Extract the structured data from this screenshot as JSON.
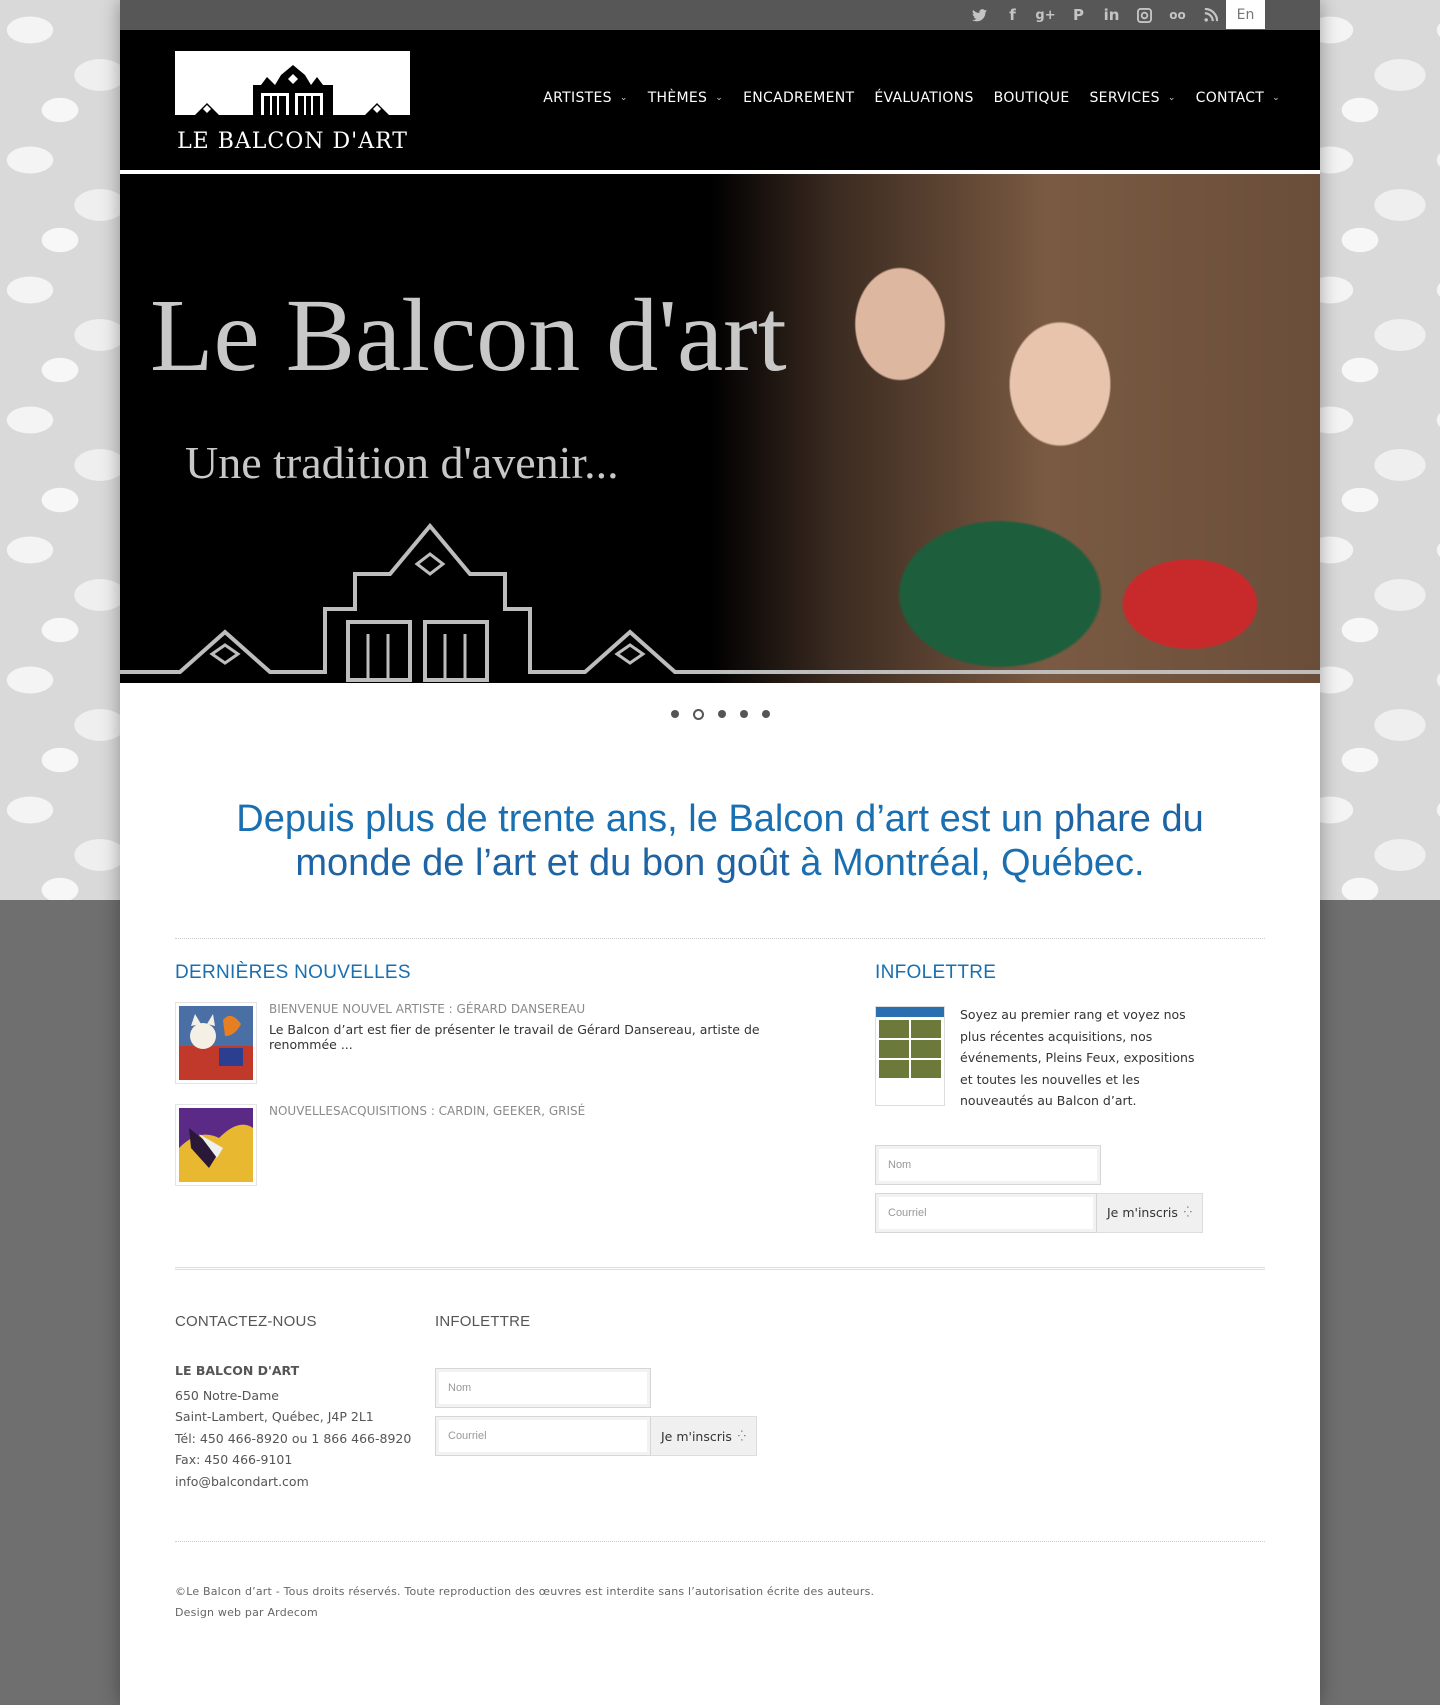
{
  "topbar": {
    "social": [
      {
        "name": "twitter-icon",
        "glyph": "🐦"
      },
      {
        "name": "facebook-icon",
        "glyph": "f"
      },
      {
        "name": "google-plus-icon",
        "glyph": "g+"
      },
      {
        "name": "pinterest-icon",
        "glyph": "P"
      },
      {
        "name": "linkedin-icon",
        "glyph": "in"
      },
      {
        "name": "instagram-icon",
        "glyph": "◙"
      },
      {
        "name": "tripadvisor-icon",
        "glyph": "oo"
      },
      {
        "name": "rss-icon",
        "glyph": ")"
      }
    ],
    "language": "En"
  },
  "header": {
    "logo_text": "LE BALCON D'ART",
    "nav": [
      {
        "label": "ARTISTES",
        "dropdown": true
      },
      {
        "label": "THÈMES",
        "dropdown": true
      },
      {
        "label": "ENCADREMENT",
        "dropdown": false
      },
      {
        "label": "ÉVALUATIONS",
        "dropdown": false
      },
      {
        "label": "BOUTIQUE",
        "dropdown": false
      },
      {
        "label": "SERVICES",
        "dropdown": true
      },
      {
        "label": "CONTACT",
        "dropdown": true
      }
    ]
  },
  "hero": {
    "title": "Le Balcon d'art",
    "subtitle": "Une tradition d'avenir...",
    "slides_count": 5,
    "active_slide": 2
  },
  "tagline": {
    "part1": "Depuis plus de trente ans, le Balcon d’art est un ",
    "part2": "phare du monde de l’art et du bon goût",
    "part3": " à Montréal, Québec."
  },
  "news": {
    "heading": "DERNIÈRES NOUVELLES",
    "items": [
      {
        "title": "BIENVENUE NOUVEL ARTISTE : GÉRARD DANSEREAU",
        "excerpt": "Le Balcon d’art est fier de présenter le travail de Gérard Dansereau, artiste de renommée ..."
      },
      {
        "title": "NOUVELLESACQUISITIONS : CARDIN, GEEKER, GRISÉ",
        "excerpt": ""
      }
    ]
  },
  "infolettre": {
    "heading": "INFOLETTRE",
    "text": "Soyez au premier rang et voyez nos plus récentes acquisitions, nos événements, Pleins Feux, expositions et toutes les nouvelles et les nouveautés au Balcon d’art.",
    "name_placeholder": "Nom",
    "email_placeholder": "Courriel",
    "button": "Je m'inscris"
  },
  "footer": {
    "contact_heading": "CONTACTEZ-NOUS",
    "company": "LE BALCON D'ART",
    "address1": "650 Notre-Dame",
    "address2": "Saint-Lambert, Québec, J4P 2L1",
    "phone": "Tél: 450 466-8920 ou 1 866 466-8920",
    "fax": "Fax: 450 466-9101",
    "email": "info@balcondart.com",
    "newsletter_heading": "INFOLETTRE",
    "name_placeholder": "Nom",
    "email_placeholder": "Courriel",
    "button": "Je m'inscris",
    "copyright": "©Le Balcon d’art - Tous droits réservés. Toute reproduction des œuvres est interdite sans l’autorisation écrite des auteurs.",
    "credit": "Design web par Ardecom"
  },
  "colors": {
    "accent_blue": "#1a6fb0",
    "header_bg": "#000000",
    "topbar_bg": "#575757"
  }
}
